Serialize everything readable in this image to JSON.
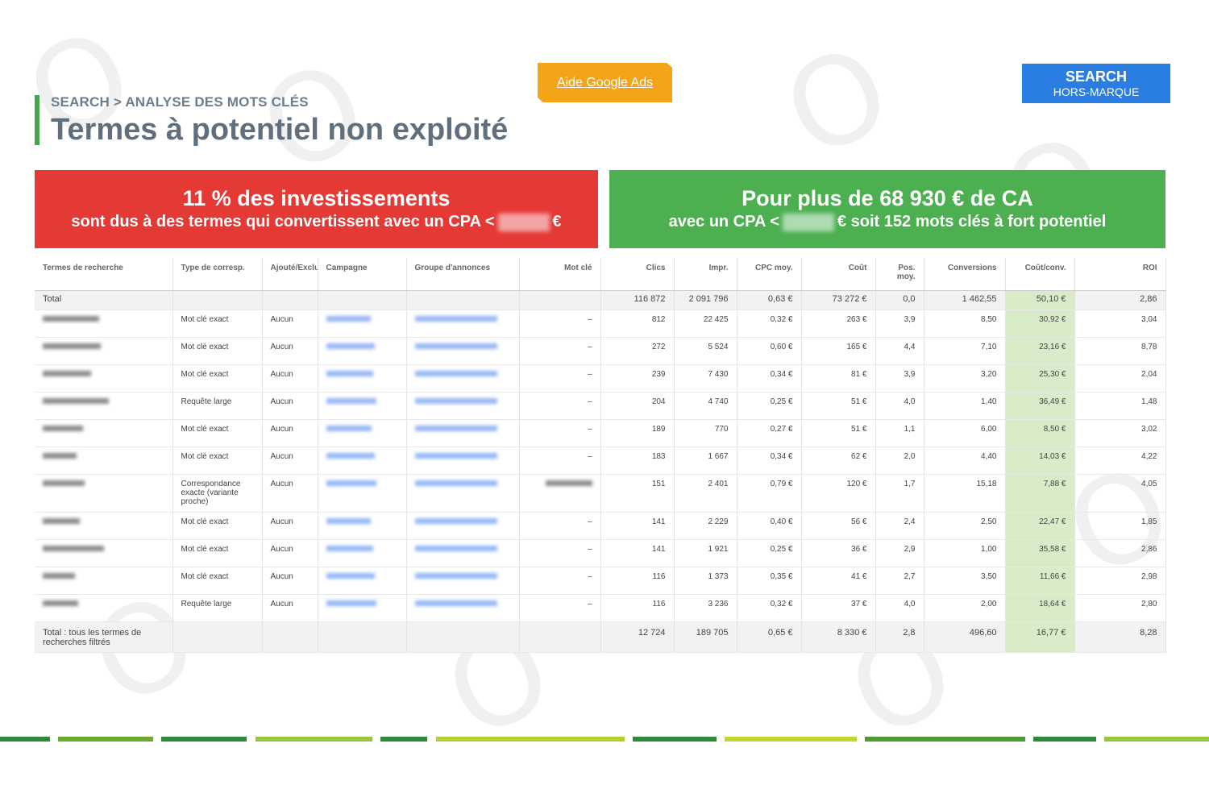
{
  "header": {
    "breadcrumb": "SEARCH > ANALYSE DES MOTS CLÉS",
    "title": "Termes à potentiel non exploité",
    "help_button": "Aide Google Ads",
    "badge_line1": "SEARCH",
    "badge_line2": "HORS-MARQUE"
  },
  "kpis": {
    "red": {
      "headline": "11 % des investissements",
      "sub_before": "sont dus à des termes qui convertissent avec un CPA <",
      "sub_after": "€",
      "color": "#e53935"
    },
    "green": {
      "headline": "Pour plus de 68 930 € de CA",
      "sub_before": "avec un CPA <",
      "sub_after": "€ soit 152 mots clés à fort potentiel",
      "color": "#4caf50"
    }
  },
  "table": {
    "columns": [
      "Termes de recherche",
      "Type de corresp.",
      "Ajouté/Exclu",
      "Campagne",
      "Groupe d'annonces",
      "Mot clé",
      "Clics",
      "Impr.",
      "CPC moy.",
      "Coût",
      "Pos. moy.",
      "Conversions",
      "Coût/conv.",
      "ROI"
    ],
    "total": {
      "label": "Total",
      "clics": "116 872",
      "impr": "2 091 796",
      "cpc": "0,63 €",
      "cout": "73 272 €",
      "pos": "0,0",
      "conv": "1 462,55",
      "cout_conv": "50,10 €",
      "roi": "2,86"
    },
    "rows": [
      {
        "type": "Mot clé exact",
        "added": "Aucun",
        "kw": "–",
        "clics": "812",
        "impr": "22 425",
        "cpc": "0,32 €",
        "cout": "263 €",
        "pos": "3,9",
        "conv": "8,50",
        "cout_conv": "30,92 €",
        "roi": "3,04"
      },
      {
        "type": "Mot clé exact",
        "added": "Aucun",
        "kw": "–",
        "clics": "272",
        "impr": "5 524",
        "cpc": "0,60 €",
        "cout": "165 €",
        "pos": "4,4",
        "conv": "7,10",
        "cout_conv": "23,16 €",
        "roi": "8,78"
      },
      {
        "type": "Mot clé exact",
        "added": "Aucun",
        "kw": "–",
        "clics": "239",
        "impr": "7 430",
        "cpc": "0,34 €",
        "cout": "81 €",
        "pos": "3,9",
        "conv": "3,20",
        "cout_conv": "25,30 €",
        "roi": "2,04"
      },
      {
        "type": "Requête large",
        "added": "Aucun",
        "kw": "–",
        "clics": "204",
        "impr": "4 740",
        "cpc": "0,25 €",
        "cout": "51 €",
        "pos": "4,0",
        "conv": "1,40",
        "cout_conv": "36,49 €",
        "roi": "1,48"
      },
      {
        "type": "Mot clé exact",
        "added": "Aucun",
        "kw": "–",
        "clics": "189",
        "impr": "770",
        "cpc": "0,27 €",
        "cout": "51 €",
        "pos": "1,1",
        "conv": "6,00",
        "cout_conv": "8,50 €",
        "roi": "3,02"
      },
      {
        "type": "Mot clé exact",
        "added": "Aucun",
        "kw": "–",
        "clics": "183",
        "impr": "1 667",
        "cpc": "0,34 €",
        "cout": "62 €",
        "pos": "2,0",
        "conv": "4,40",
        "cout_conv": "14,03 €",
        "roi": "4,22"
      },
      {
        "type": "Correspondance exacte (variante proche)",
        "added": "Aucun",
        "kw": "",
        "clics": "151",
        "impr": "2 401",
        "cpc": "0,79 €",
        "cout": "120 €",
        "pos": "1,7",
        "conv": "15,18",
        "cout_conv": "7,88 €",
        "roi": "4,05"
      },
      {
        "type": "Mot clé exact",
        "added": "Aucun",
        "kw": "–",
        "clics": "141",
        "impr": "2 229",
        "cpc": "0,40 €",
        "cout": "56 €",
        "pos": "2,4",
        "conv": "2,50",
        "cout_conv": "22,47 €",
        "roi": "1,85"
      },
      {
        "type": "Mot clé exact",
        "added": "Aucun",
        "kw": "–",
        "clics": "141",
        "impr": "1 921",
        "cpc": "0,25 €",
        "cout": "36 €",
        "pos": "2,9",
        "conv": "1,00",
        "cout_conv": "35,58 €",
        "roi": "2,86"
      },
      {
        "type": "Mot clé exact",
        "added": "Aucun",
        "kw": "–",
        "clics": "116",
        "impr": "1 373",
        "cpc": "0,35 €",
        "cout": "41 €",
        "pos": "2,7",
        "conv": "3,50",
        "cout_conv": "11,66 €",
        "roi": "2,98"
      },
      {
        "type": "Requête large",
        "added": "Aucun",
        "kw": "–",
        "clics": "116",
        "impr": "3 236",
        "cpc": "0,32 €",
        "cout": "37 €",
        "pos": "4,0",
        "conv": "2,00",
        "cout_conv": "18,64 €",
        "roi": "2,80"
      }
    ],
    "footer": {
      "label": "Total : tous les termes de recherches filtrés",
      "clics": "12 724",
      "impr": "189 705",
      "cpc": "0,65 €",
      "cout": "8 330 €",
      "pos": "2,8",
      "conv": "496,60",
      "cout_conv": "16,77 €",
      "roi": "8,28"
    }
  },
  "colors": {
    "accent": "#43a747",
    "help": "#f5a41a",
    "badge": "#2a7de1",
    "highlight": "#d9ecc9"
  }
}
